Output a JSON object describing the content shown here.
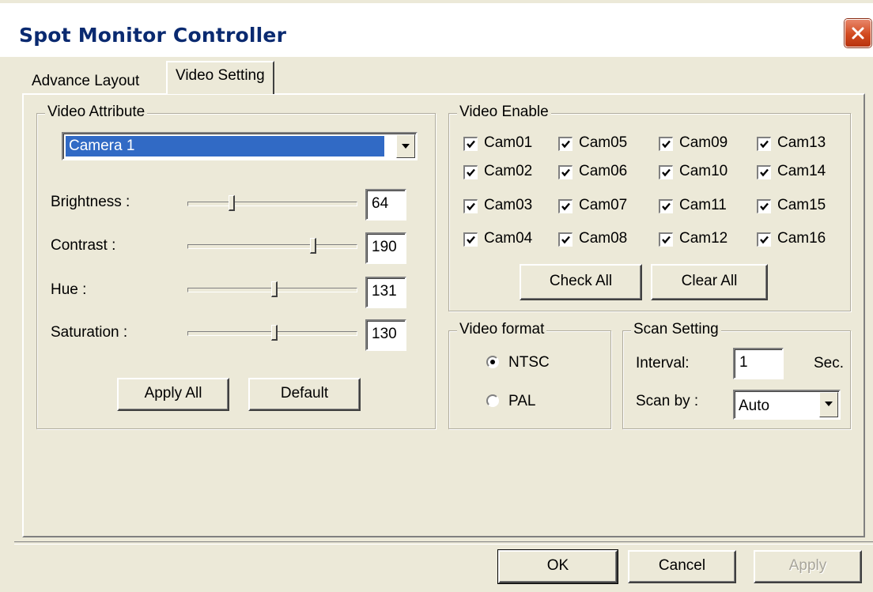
{
  "window": {
    "title": "Spot Monitor Controller"
  },
  "tabs": [
    {
      "label": "Advance Layout",
      "active": false
    },
    {
      "label": "Video Setting",
      "active": true
    }
  ],
  "video_attribute": {
    "legend": "Video Attribute",
    "camera_select": {
      "selected": "Camera 1"
    },
    "sliders": [
      {
        "label": "Brightness :",
        "value": "64",
        "position": 0.25
      },
      {
        "label": "Contrast :",
        "value": "190",
        "position": 0.75
      },
      {
        "label": "Hue :",
        "value": "131",
        "position": 0.51
      },
      {
        "label": "Saturation :",
        "value": "130",
        "position": 0.51
      }
    ],
    "apply_all_label": "Apply All",
    "default_label": "Default"
  },
  "video_enable": {
    "legend": "Video Enable",
    "cameras": [
      {
        "label": "Cam01",
        "checked": true
      },
      {
        "label": "Cam05",
        "checked": true
      },
      {
        "label": "Cam09",
        "checked": true
      },
      {
        "label": "Cam13",
        "checked": true
      },
      {
        "label": "Cam02",
        "checked": true
      },
      {
        "label": "Cam06",
        "checked": true
      },
      {
        "label": "Cam10",
        "checked": true
      },
      {
        "label": "Cam14",
        "checked": true
      },
      {
        "label": "Cam03",
        "checked": true
      },
      {
        "label": "Cam07",
        "checked": true
      },
      {
        "label": "Cam11",
        "checked": true
      },
      {
        "label": "Cam15",
        "checked": true
      },
      {
        "label": "Cam04",
        "checked": true
      },
      {
        "label": "Cam08",
        "checked": true
      },
      {
        "label": "Cam12",
        "checked": true
      },
      {
        "label": "Cam16",
        "checked": true
      }
    ],
    "check_all_label": "Check All",
    "clear_all_label": "Clear All"
  },
  "video_format": {
    "legend": "Video format",
    "options": [
      {
        "label": "NTSC",
        "selected": true
      },
      {
        "label": "PAL",
        "selected": false
      }
    ]
  },
  "scan_setting": {
    "legend": "Scan Setting",
    "interval_label": "Interval:",
    "interval_value": "1",
    "interval_unit": "Sec.",
    "scan_by_label": "Scan by :",
    "scan_by_value": "Auto"
  },
  "footer": {
    "ok_label": "OK",
    "cancel_label": "Cancel",
    "apply_label": "Apply"
  },
  "colors": {
    "face": "#ece9d8",
    "title_text": "#0a2a70",
    "selection": "#316ac5",
    "close_button": "#d24a1f"
  }
}
